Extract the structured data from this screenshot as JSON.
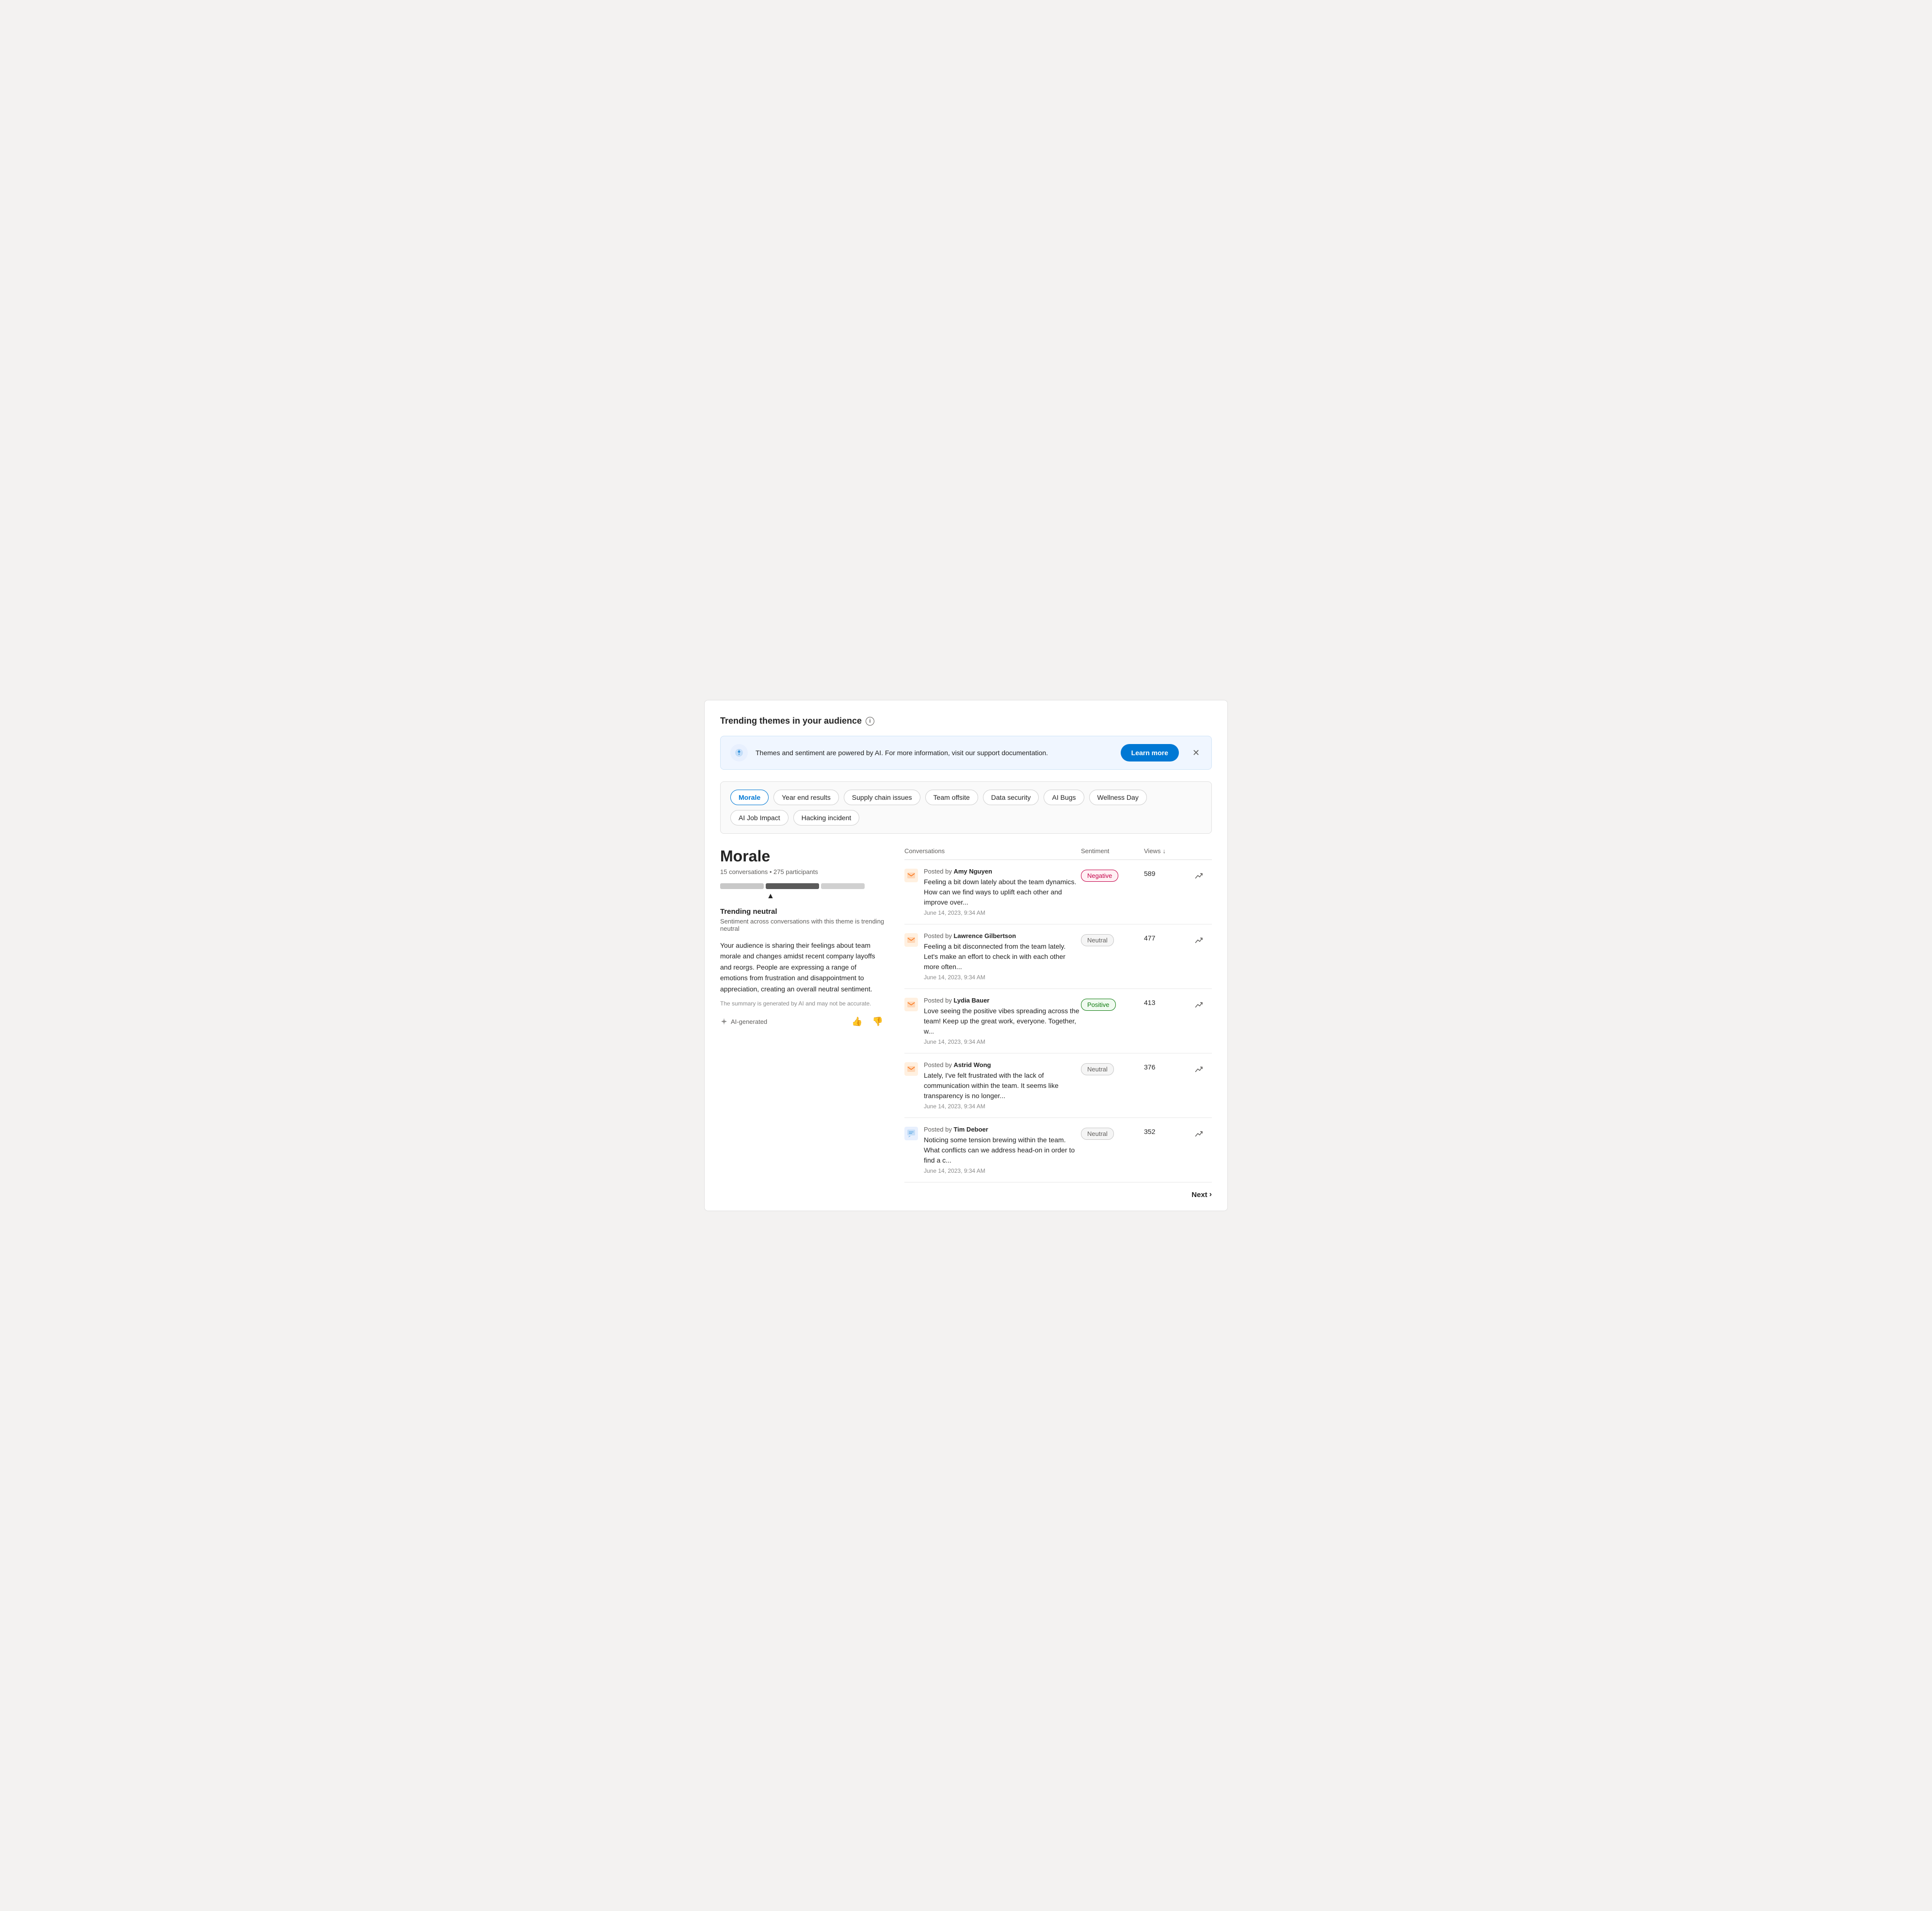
{
  "page": {
    "title": "Trending themes in your audience"
  },
  "banner": {
    "text": "Themes and sentiment are powered by AI. For more information, visit our support documentation.",
    "learn_more_label": "Learn more"
  },
  "themes": [
    {
      "id": "morale",
      "label": "Morale",
      "active": true
    },
    {
      "id": "year-end",
      "label": "Year end results",
      "active": false
    },
    {
      "id": "supply-chain",
      "label": "Supply chain issues",
      "active": false
    },
    {
      "id": "team-offsite",
      "label": "Team offsite",
      "active": false
    },
    {
      "id": "data-security",
      "label": "Data security",
      "active": false
    },
    {
      "id": "ai-bugs",
      "label": "AI Bugs",
      "active": false
    },
    {
      "id": "wellness-day",
      "label": "Wellness Day",
      "active": false
    },
    {
      "id": "ai-job-impact",
      "label": "AI Job Impact",
      "active": false
    },
    {
      "id": "hacking-incident",
      "label": "Hacking incident",
      "active": false
    }
  ],
  "detail": {
    "theme_name": "Morale",
    "stats": "15 conversations • 275 participants",
    "trending_label": "Trending neutral",
    "trending_sub": "Sentiment across conversations with this theme is trending neutral",
    "description": "Your audience is sharing their feelings about team morale and changes amidst recent company layoffs and reorgs. People are expressing a range of emotions from frustration and disappointment to appreciation, creating an overall neutral sentiment.",
    "disclaimer": "The summary is generated by AI and may not be accurate.",
    "ai_badge": "AI-generated"
  },
  "table": {
    "col_conversations": "Conversations",
    "col_sentiment": "Sentiment",
    "col_views": "Views",
    "sort_icon": "↓"
  },
  "conversations": [
    {
      "poster": "Amy Nguyen",
      "text": "Feeling a bit down lately about the team dynamics. How can we find ways to uplift each other and improve over...",
      "date": "June 14, 2023, 9:34 AM",
      "sentiment": "Negative",
      "sentiment_class": "negative",
      "views": "589",
      "icon_color": "orange"
    },
    {
      "poster": "Lawrence Gilbertson",
      "text": "Feeling a bit disconnected from the team lately. Let's make an effort to check in with each other more often...",
      "date": "June 14, 2023, 9:34 AM",
      "sentiment": "Neutral",
      "sentiment_class": "neutral",
      "views": "477",
      "icon_color": "orange"
    },
    {
      "poster": "Lydia Bauer",
      "text": "Love seeing the positive vibes spreading across the team! Keep up the great work, everyone. Together, w...",
      "date": "June 14, 2023, 9:34 AM",
      "sentiment": "Positive",
      "sentiment_class": "positive",
      "views": "413",
      "icon_color": "orange"
    },
    {
      "poster": "Astrid Wong",
      "text": "Lately, I've felt frustrated with the lack of communication within the team. It seems like transparency is no longer...",
      "date": "June 14, 2023, 9:34 AM",
      "sentiment": "Neutral",
      "sentiment_class": "neutral",
      "views": "376",
      "icon_color": "orange"
    },
    {
      "poster": "Tim Deboer",
      "text": "Noticing some tension brewing within the team. What conflicts can we address head-on in order to find a c...",
      "date": "June 14, 2023, 9:34 AM",
      "sentiment": "Neutral",
      "sentiment_class": "neutral",
      "views": "352",
      "icon_color": "blue"
    }
  ],
  "pagination": {
    "next_label": "Next"
  }
}
